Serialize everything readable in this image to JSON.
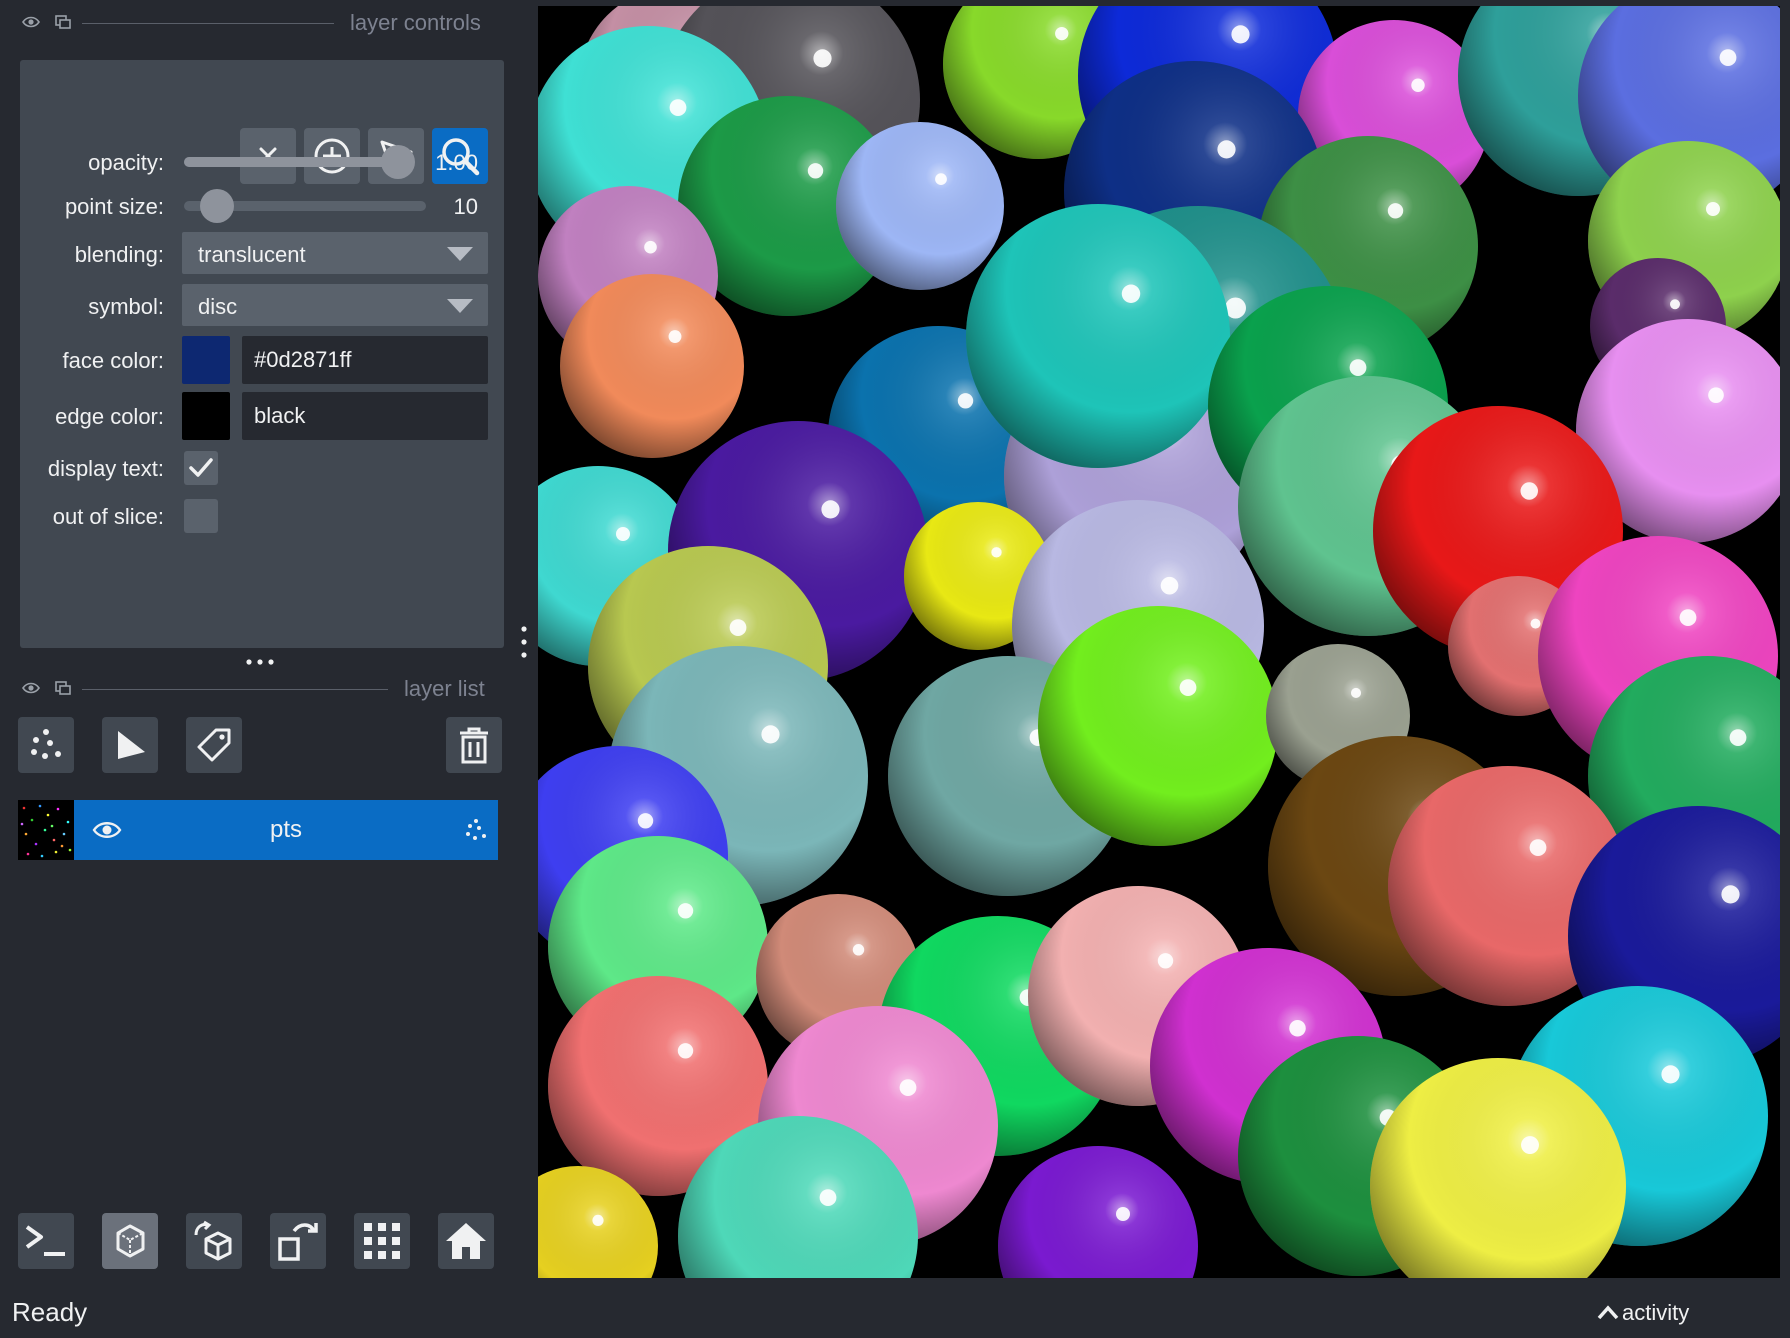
{
  "layer_controls": {
    "title": "layer controls",
    "header_icons": [
      "eye-icon",
      "float-window-icon"
    ],
    "mode_buttons": [
      {
        "name": "delete-points-button",
        "icon": "close-icon",
        "active": false
      },
      {
        "name": "add-points-button",
        "icon": "add-circle-icon",
        "active": false
      },
      {
        "name": "select-points-button",
        "icon": "pointer-arrow-icon",
        "active": false
      },
      {
        "name": "pan-zoom-button",
        "icon": "zoom-icon",
        "active": true
      }
    ],
    "opacity": {
      "label": "opacity:",
      "value": 1.0,
      "value_text": "1.00"
    },
    "point_size": {
      "label": "point size:",
      "value": 10,
      "value_text": "10",
      "min": 1,
      "max": 100
    },
    "blending": {
      "label": "blending:",
      "value": "translucent"
    },
    "symbol": {
      "label": "symbol:",
      "value": "disc"
    },
    "face_color": {
      "label": "face color:",
      "value": "#0d2871ff",
      "swatch": "#0d2871"
    },
    "edge_color": {
      "label": "edge color:",
      "value": "black",
      "swatch": "#000000"
    },
    "display_text": {
      "label": "display text:",
      "checked": true
    },
    "out_of_slice": {
      "label": "out of slice:",
      "checked": false
    }
  },
  "layer_list": {
    "title": "layer list",
    "header_icons": [
      "eye-icon",
      "float-window-icon"
    ],
    "buttons": [
      "new-points-layer-icon",
      "new-shapes-layer-icon",
      "new-labels-layer-icon",
      "delete-layer-icon"
    ],
    "layers": [
      {
        "name": "pts",
        "visible": true,
        "type_icon": "points-layer-icon",
        "selected": true
      }
    ]
  },
  "bottom_buttons": [
    {
      "name": "console-button",
      "icon": "terminal-icon",
      "active": false
    },
    {
      "name": "ndisplay-button",
      "icon": "cube-3d-icon",
      "active": true
    },
    {
      "name": "roll-dims-button",
      "icon": "roll-cube-icon",
      "active": false
    },
    {
      "name": "transpose-button",
      "icon": "transpose-icon",
      "active": false
    },
    {
      "name": "grid-button",
      "icon": "grid-icon",
      "active": false
    },
    {
      "name": "home-button",
      "icon": "home-icon",
      "active": false
    }
  ],
  "status": {
    "text": "Ready",
    "activity_label": "activity"
  },
  "colors": {
    "accent": "#0a6cc4",
    "panel": "#414851",
    "background": "#262930",
    "control": "#5a626c"
  }
}
